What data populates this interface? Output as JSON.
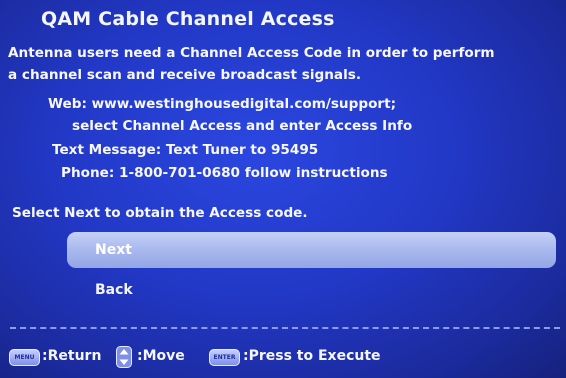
{
  "title": "QAM Cable Channel Access",
  "body": {
    "line1": "Antenna users need a Channel Access Code in order to perform",
    "line2": "a channel scan and receive broadcast signals.",
    "web": "Web: www.westinghousedigital.com/support;",
    "web_instructions": "select Channel Access and enter Access Info",
    "text_message": "Text Message: Text Tuner to 95495",
    "phone": "Phone: 1-800-701-0680 follow instructions",
    "prompt": "Select Next to obtain the Access code."
  },
  "menu": {
    "items": [
      {
        "label": "Next",
        "selected": true
      },
      {
        "label": "Back",
        "selected": false
      }
    ]
  },
  "footer": {
    "menu_key": "MENU",
    "return_label": ":Return",
    "move_icon": "up-down-arrows-icon",
    "move_label": ":Move",
    "enter_key": "ENTER",
    "execute_label": ":Press to Execute"
  },
  "colors": {
    "background": "#2238c6",
    "highlight": "#a9b8ee",
    "text": "#ffffff",
    "divider": "#8c9bf0"
  }
}
